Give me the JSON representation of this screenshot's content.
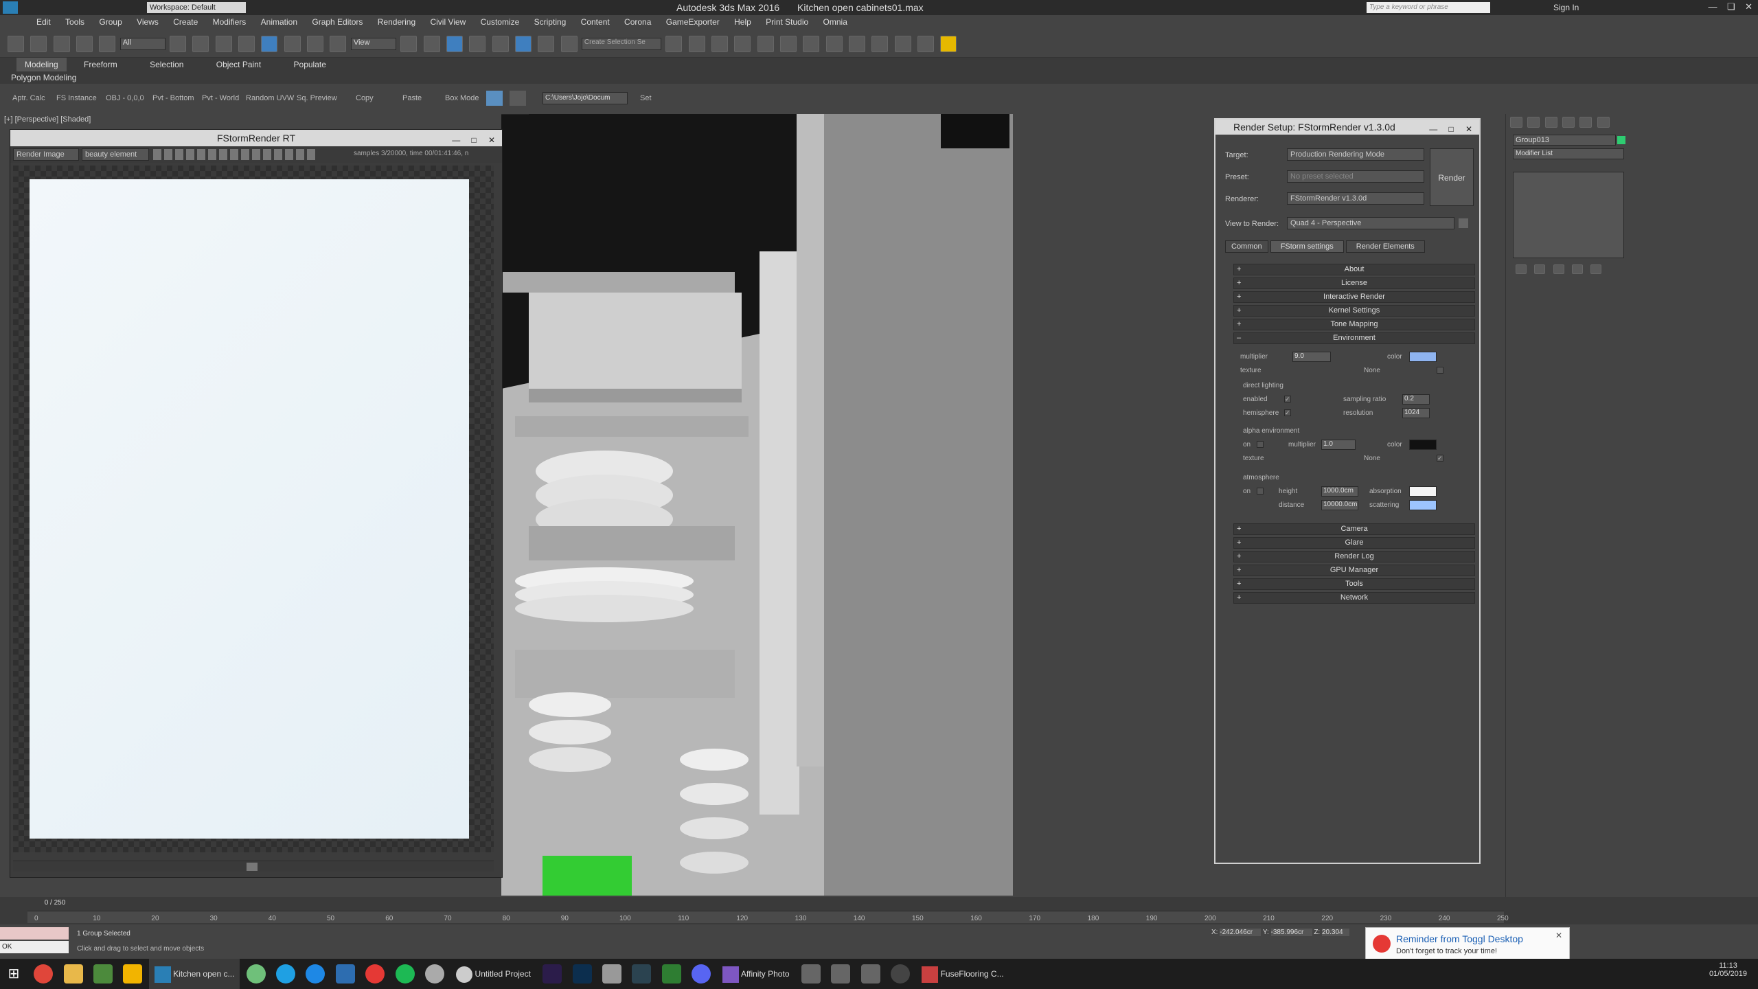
{
  "title_bar": {
    "app_title": "Autodesk 3ds Max 2016",
    "file_name": "Kitchen open cabinets01.max",
    "workspace": "Workspace: Default",
    "search_placeholder": "Type a keyword or phrase",
    "sign_in": "Sign In"
  },
  "menu": [
    "Edit",
    "Tools",
    "Group",
    "Views",
    "Create",
    "Modifiers",
    "Animation",
    "Graph Editors",
    "Rendering",
    "Civil View",
    "Customize",
    "Scripting",
    "Content",
    "Corona",
    "GameExporter",
    "Help",
    "Print Studio",
    "Omnia"
  ],
  "toolbar": {
    "selection_filter": "All",
    "ref_coord": "View",
    "named_selection": "Create Selection Se"
  },
  "ribbon": {
    "tabs": [
      "Modeling",
      "Freeform",
      "Selection",
      "Object Paint",
      "Populate"
    ],
    "sub": "Polygon Modeling"
  },
  "tools_row": {
    "items": [
      "Aptr. Calc",
      "FS Instance",
      "OBJ - 0,0,0",
      "Pvt - Bottom",
      "Pvt - World",
      "Random UVW",
      "Sq. Preview",
      "Copy",
      "Paste",
      "Box Mode"
    ],
    "path": "C:\\Users\\Jojo\\Docum",
    "set": "Set"
  },
  "viewport": {
    "label": "[+] [Perspective] [Shaded]"
  },
  "fstorm": {
    "title": "FStormRender RT",
    "mode": "Render Image",
    "element": "beauty element",
    "status": "samples 3/20000,  time 00/01:41:46,  n"
  },
  "render_setup": {
    "title": "Render Setup: FStormRender v1.3.0d",
    "target_label": "Target:",
    "target_value": "Production Rendering Mode",
    "preset_label": "Preset:",
    "preset_value": "No preset selected",
    "renderer_label": "Renderer:",
    "renderer_value": "FStormRender v1.3.0d",
    "view_label": "View to Render:",
    "view_value": "Quad 4 - Perspective",
    "render_button": "Render",
    "tabs": [
      "Common",
      "FStorm settings",
      "Render Elements"
    ],
    "rollouts_top": [
      "About",
      "License",
      "Interactive Render",
      "Kernel Settings",
      "Tone Mapping"
    ],
    "environment": {
      "title": "Environment",
      "multiplier_label": "multiplier",
      "multiplier_value": "9.0",
      "color_label": "color",
      "texture_label": "texture",
      "texture_value": "None",
      "direct_lighting": "direct lighting",
      "enabled": "enabled",
      "sampling_ratio": "sampling ratio",
      "sampling_ratio_value": "0.2",
      "hemisphere": "hemisphere",
      "resolution": "resolution",
      "resolution_value": "1024",
      "alpha_env": "alpha environment",
      "on": "on",
      "alpha_multiplier_value": "1.0",
      "alpha_texture_value": "None",
      "atmosphere": "atmosphere",
      "height": "height",
      "height_value": "1000.0cm",
      "absorption": "absorption",
      "distance": "distance",
      "distance_value": "10000.0cm",
      "scattering": "scattering"
    },
    "rollouts_bottom": [
      "Camera",
      "Glare",
      "Render Log",
      "GPU Manager",
      "Tools",
      "Network"
    ],
    "env_color": "#8fb4f0",
    "scatter_color": "#9cc4ff"
  },
  "command_panel": {
    "object_name": "Group013",
    "modifier_list": "Modifier List"
  },
  "timeline": {
    "frame": "0 / 250",
    "ticks": [
      "0",
      "10",
      "20",
      "30",
      "40",
      "50",
      "60",
      "70",
      "80",
      "90",
      "100",
      "110",
      "120",
      "130",
      "140",
      "150",
      "160",
      "170",
      "180",
      "190",
      "200",
      "210",
      "220",
      "230",
      "240",
      "250"
    ]
  },
  "status": {
    "selected": "1 Group Selected",
    "prompt": "Click and drag to select and move objects",
    "x": "-242.046cr",
    "y": "-385.996cr",
    "z": "20.304",
    "listener": "OK"
  },
  "toggl": {
    "title": "Reminder from Toggl Desktop",
    "body": "Don't forget to track your time!"
  },
  "taskbar": {
    "items": [
      "Kitchen open c...",
      "Untitled Project",
      "Affinity Photo",
      "FuseFlooring C..."
    ],
    "time": "11:13",
    "date": "01/05/2019"
  }
}
